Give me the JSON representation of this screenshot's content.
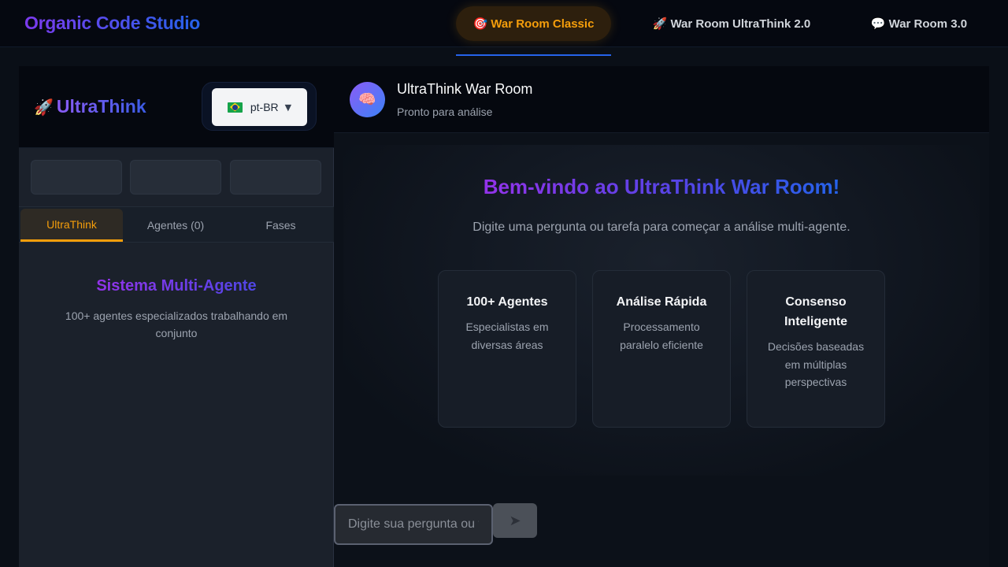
{
  "app": {
    "brand": "Organic Code Studio"
  },
  "nav": {
    "tabs": [
      {
        "icon": "🎯",
        "icon_name": "target-icon",
        "label": "War Room Classic",
        "active": true
      },
      {
        "icon": "🚀",
        "icon_name": "rocket-icon",
        "label": "War Room UltraThink 2.0",
        "active": false
      },
      {
        "icon": "💬",
        "icon_name": "speech-bubble-icon",
        "label": "War Room 3.0",
        "active": false
      }
    ]
  },
  "sidebar": {
    "logo_icon": "🚀",
    "logo_text": "UltraThink",
    "language": {
      "flag": "brazil-flag-icon",
      "value": "pt-BR",
      "caret": "▼"
    },
    "tabs": [
      {
        "label": "UltraThink",
        "active": true
      },
      {
        "label": "Agentes (0)",
        "active": false
      },
      {
        "label": "Fases",
        "active": false
      }
    ],
    "panel": {
      "title": "Sistema Multi-Agente",
      "description": "100+ agentes especializados trabalhando em conjunto"
    }
  },
  "chat": {
    "avatar_icon": "🧠",
    "title": "UltraThink War Room",
    "status": "Pronto para análise",
    "welcome": {
      "title": "Bem-vindo ao UltraThink War Room!",
      "subtitle": "Digite uma pergunta ou tarefa para começar a análise multi-agente."
    },
    "cards": [
      {
        "title": "100+ Agentes",
        "text": "Especialistas em diversas áreas"
      },
      {
        "title": "Análise Rápida",
        "text": "Processamento paralelo eficiente"
      },
      {
        "title": "Consenso Inteligente",
        "text": "Decisões baseadas em múltiplas perspectivas"
      }
    ],
    "input": {
      "placeholder": "Digite sua pergunta ou tarefa...",
      "value": ""
    },
    "send_icon": "➤"
  },
  "colors": {
    "accent_orange": "#f59e0b",
    "accent_blue": "#2563eb",
    "accent_purple": "#9333ea",
    "background": "#0a0f17"
  }
}
